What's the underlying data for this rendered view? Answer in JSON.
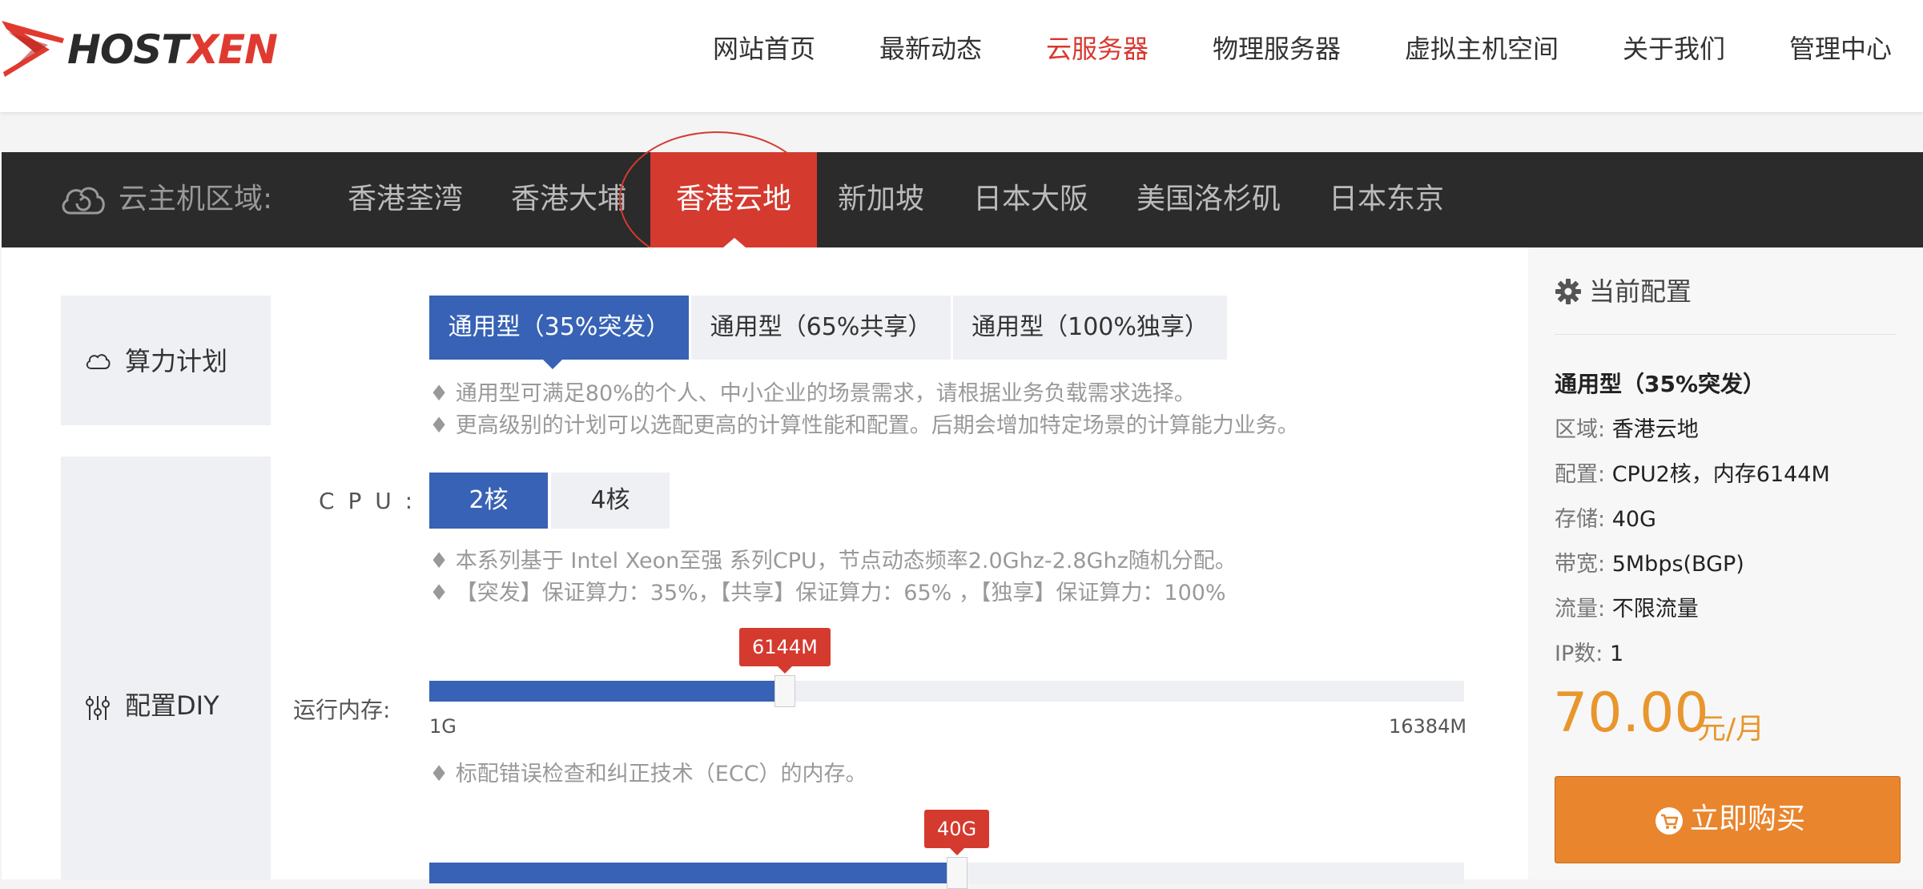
{
  "brand": {
    "logo_prefix": "HOST",
    "logo_suffix": "XEN"
  },
  "nav": {
    "items": [
      "网站首页",
      "最新动态",
      "云服务器",
      "物理服务器",
      "虚拟主机空间",
      "关于我们",
      "管理中心"
    ],
    "active": "云服务器",
    "active_color": "#d9372e"
  },
  "region": {
    "label": "云主机区域:",
    "tabs": [
      "香港荃湾",
      "香港大埔",
      "香港云地",
      "新加坡",
      "日本大阪",
      "美国洛杉矶",
      "日本东京"
    ],
    "active": "香港云地"
  },
  "plan": {
    "section_label": "算力计划",
    "options": [
      "通用型（35%突发）",
      "通用型（65%共享）",
      "通用型（100%独享）"
    ],
    "selected": "通用型（35%突发）",
    "notes": [
      "♦ 通用型可满足80%的个人、中小企业的场景需求，请根据业务负载需求选择。",
      "♦ 更高级别的计划可以选配更高的计算性能和配置。后期会增加特定场景的计算能力业务。"
    ]
  },
  "diy": {
    "section_label": "配置DIY",
    "cpu": {
      "label": "C P U :",
      "options": [
        "2核",
        "4核"
      ],
      "selected": "2核",
      "notes": [
        "♦ 本系列基于 Intel Xeon至强 系列CPU，节点动态频率2.0Ghz-2.8Ghz随机分配。",
        "♦ 【突发】保证算力：35%，【共享】保证算力：65% ，【独享】保证算力：100%"
      ]
    },
    "memory": {
      "label": "运行内存:",
      "value_label": "6144M",
      "min_label": "1G",
      "max_label": "16384M",
      "value": 6144,
      "min": 1024,
      "max": 16384,
      "note": "♦ 标配错误检查和纠正技术（ECC）的内存。"
    },
    "storage": {
      "value_label": "40G",
      "fill_fraction": 0.5
    }
  },
  "summary": {
    "title": "当前配置",
    "plan": "通用型（35%突发）",
    "rows": [
      {
        "k": "区域:",
        "v": "香港云地"
      },
      {
        "k": "配置:",
        "v": "CPU2核，内存6144M"
      },
      {
        "k": "存储:",
        "v": "40G"
      },
      {
        "k": "带宽:",
        "v": "5Mbps(BGP)"
      },
      {
        "k": "流量:",
        "v": "不限流量"
      },
      {
        "k": "IP数:",
        "v": "1"
      }
    ],
    "price": "70.00",
    "price_unit": "元/月",
    "buy_label": "立即购买"
  },
  "colors": {
    "primary_blue": "#3762b5",
    "accent_red": "#d53a2f",
    "price_orange": "#e8962e",
    "buy_orange": "#e9852d",
    "dark_bar": "#2b2b2b"
  }
}
